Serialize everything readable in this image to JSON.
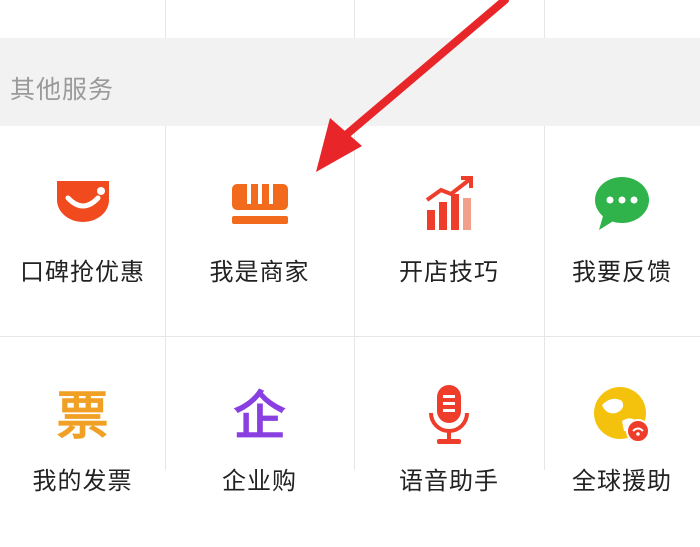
{
  "section": {
    "title": "其他服务"
  },
  "services": [
    {
      "label": "口碑抢优惠",
      "icon": "koubei-bag-icon",
      "color": "#f04a1e"
    },
    {
      "label": "我是商家",
      "icon": "merchant-store-icon",
      "color": "#f26a1b"
    },
    {
      "label": "开店技巧",
      "icon": "growth-chart-icon",
      "color": "#ee3d2a"
    },
    {
      "label": "我要反馈",
      "icon": "chat-bubble-icon",
      "color": "#2fb34a"
    },
    {
      "label": "我的发票",
      "icon": "invoice-icon",
      "color": "#f0a024"
    },
    {
      "label": "企业购",
      "icon": "enterprise-icon",
      "color": "#8a3fe0"
    },
    {
      "label": "语音助手",
      "icon": "microphone-icon",
      "color": "#ee3d2a"
    },
    {
      "label": "全球援助",
      "icon": "globe-icon",
      "color": "#f4c20d"
    }
  ],
  "icon_glyphs": {
    "invoice": "票",
    "enterprise": "企"
  },
  "annotation": {
    "arrow_color": "#e8262a"
  }
}
